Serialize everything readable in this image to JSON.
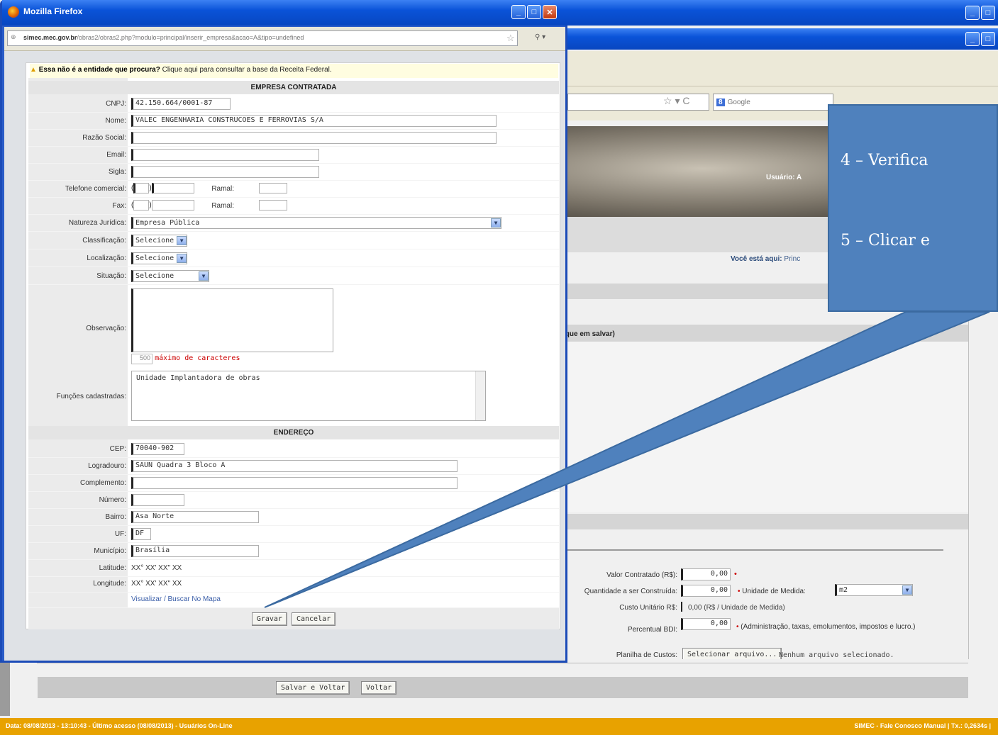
{
  "background_window": {
    "search_engine": "Google",
    "user_label": "Usuário: A",
    "breadcrumb_prefix": "Você está aqui:",
    "breadcrumb_value": "Princ",
    "section_hint": "ique em salvar)",
    "form": {
      "valor_contratado_label": "Valor Contratado (R$):",
      "valor_contratado_value": "0,00",
      "quantidade_label": "Quantidade a ser Construída:",
      "quantidade_value": "0,00",
      "unidade_label": "Unidade de Medida:",
      "unidade_value": "m2",
      "custo_label": "Custo Unitário R$:",
      "custo_value": "0,00 (R$ / Unidade de Medida)",
      "bdi_label": "Percentual BDI:",
      "bdi_value": "0,00",
      "bdi_note": "(Administração, taxas, emolumentos, impostos e lucro.)",
      "planilha_label": "Planilha de Custos:",
      "planilha_button": "Selecionar arquivo...",
      "planilha_status": "Nenhum arquivo selecionado."
    },
    "salvar_voltar_button": "Salvar e Voltar",
    "voltar_button": "Voltar",
    "status_left": "Data: 08/08/2013 - 13:10:43 - Último acesso (08/08/2013) - Usuários On-Line",
    "status_right": "SIMEC - Fale Conosco Manual   | Tx.: 0,2634s |"
  },
  "popup": {
    "title": "Mozilla Firefox",
    "url_domain": "simec.mec.gov.br",
    "url_path": "/obras2/obras2.php?modulo=principal/inserir_empresa&acao=A&tipo=undefined",
    "warning_bold": "Essa não é a entidade que procura?",
    "warning_text": "Clique aqui para consultar a base da Receita Federal.",
    "section_empresa": "EMPRESA CONTRATADA",
    "section_endereco": "ENDEREÇO",
    "fields": {
      "cnpj_label": "CNPJ:",
      "cnpj_value": "42.150.664/0001-87",
      "nome_label": "Nome:",
      "nome_value": "VALEC ENGENHARIA CONSTRUCOES E FERROVIAS S/A",
      "razao_label": "Razão Social:",
      "razao_value": "",
      "email_label": "Email:",
      "email_value": "",
      "sigla_label": "Sigla:",
      "sigla_value": "",
      "telefone_label": "Telefone comercial:",
      "ramal_label": "Ramal:",
      "fax_label": "Fax:",
      "natureza_label": "Natureza Jurídica:",
      "natureza_value": "Empresa Pública",
      "classificacao_label": "Classificação:",
      "classificacao_value": "Selecione",
      "localizacao_label": "Localização:",
      "localizacao_value": "Selecione",
      "situacao_label": "Situação:",
      "situacao_value": "Selecione",
      "observacao_label": "Observação:",
      "observacao_counter": "500",
      "observacao_max": "máximo de caracteres",
      "funcoes_label": "Funções cadastradas:",
      "funcoes_value": "Unidade Implantadora de obras",
      "cep_label": "CEP:",
      "cep_value": "70040-902",
      "logradouro_label": "Logradouro:",
      "logradouro_value": "SAUN Quadra 3 Bloco A",
      "complemento_label": "Complemento:",
      "complemento_value": "",
      "numero_label": "Número:",
      "numero_value": "",
      "bairro_label": "Bairro:",
      "bairro_value": "Asa Norte",
      "uf_label": "UF:",
      "uf_value": "DF",
      "municipio_label": "Município:",
      "municipio_value": "Brasília",
      "latitude_label": "Latitude:",
      "latitude_value": "XX° XX' XX\" XX",
      "longitude_label": "Longitude:",
      "longitude_value": "XX° XX' XX\" XX",
      "mapa_link": "Visualizar / Buscar No Mapa"
    },
    "gravar_button": "Gravar",
    "cancelar_button": "Cancelar"
  },
  "callout": {
    "line1": "4 – Verifica",
    "line2": "5 – Clicar e",
    "color": "#4f81bd"
  }
}
